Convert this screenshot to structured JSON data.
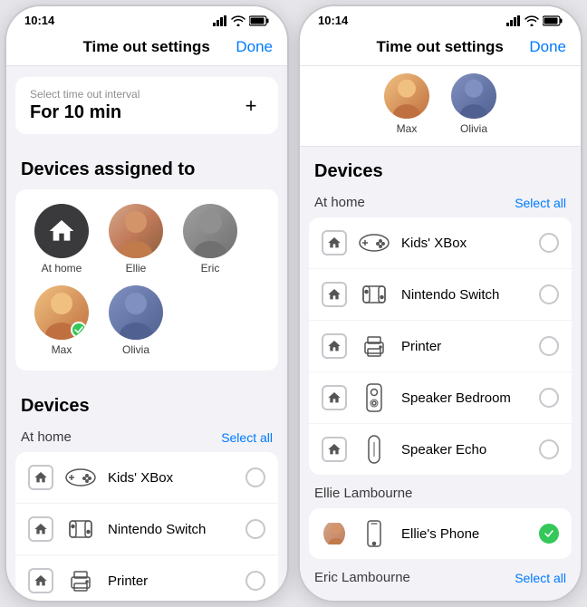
{
  "phone1": {
    "statusBar": {
      "time": "10:14",
      "signal": "signal",
      "wifi": "wifi",
      "battery": "battery"
    },
    "navBar": {
      "title": "Time out settings",
      "doneLabel": "Done"
    },
    "timeInterval": {
      "label": "Select time out interval",
      "value": "For 10 min",
      "plusIcon": "+"
    },
    "devicesAssigned": {
      "sectionTitle": "Devices assigned to",
      "avatars": [
        {
          "name": "At home",
          "type": "home"
        },
        {
          "name": "Ellie",
          "type": "photo",
          "photoClass": "photo-ellie"
        },
        {
          "name": "Eric",
          "type": "photo",
          "photoClass": "photo-eric"
        },
        {
          "name": "Max",
          "type": "photo",
          "photoClass": "photo-max",
          "checked": true
        },
        {
          "name": "Olivia",
          "type": "photo",
          "photoClass": "photo-olivia"
        }
      ]
    },
    "devices": {
      "sectionTitle": "Devices",
      "locations": [
        {
          "name": "At home",
          "selectAllLabel": "Select all",
          "items": [
            {
              "name": "Kids' XBox",
              "icon": "gamepad",
              "active": false
            },
            {
              "name": "Nintendo Switch",
              "icon": "switch",
              "active": false
            },
            {
              "name": "Printer",
              "icon": "printer",
              "active": false
            }
          ]
        }
      ]
    }
  },
  "phone2": {
    "statusBar": {
      "time": "10:14"
    },
    "navBar": {
      "title": "Time out settings",
      "doneLabel": "Done"
    },
    "topAvatars": [
      {
        "name": "Max",
        "photoClass": "photo-max"
      },
      {
        "name": "Olivia",
        "photoClass": "photo-olivia"
      }
    ],
    "devices": {
      "sectionTitle": "Devices",
      "locations": [
        {
          "name": "At home",
          "selectAllLabel": "Select all",
          "items": [
            {
              "name": "Kids' XBox",
              "icon": "gamepad",
              "active": false
            },
            {
              "name": "Nintendo Switch",
              "icon": "switch",
              "active": false
            },
            {
              "name": "Printer",
              "icon": "printer",
              "active": false
            },
            {
              "name": "Speaker Bedroom",
              "icon": "speaker",
              "active": false
            },
            {
              "name": "Speaker Echo",
              "icon": "echo",
              "active": false
            }
          ]
        },
        {
          "name": "Ellie Lambourne",
          "selectAllLabel": "",
          "items": [
            {
              "name": "Ellie's Phone",
              "icon": "phone",
              "active": true
            }
          ]
        },
        {
          "name": "Eric Lambourne",
          "selectAllLabel": "Select all",
          "items": []
        }
      ]
    }
  }
}
